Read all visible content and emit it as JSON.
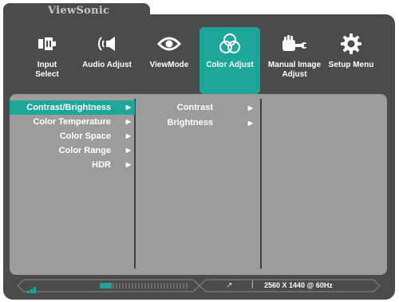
{
  "brand": "ViewSonic",
  "tabs": [
    {
      "label": "Input\nSelect",
      "icon": "input-select-icon"
    },
    {
      "label": "Audio Adjust",
      "icon": "speaker-icon"
    },
    {
      "label": "ViewMode",
      "icon": "eye-icon"
    },
    {
      "label": "Color Adjust",
      "icon": "color-circles-icon",
      "active": true
    },
    {
      "label": "Manual Image\nAdjust",
      "icon": "hand-wrench-icon"
    },
    {
      "label": "Setup Menu",
      "icon": "gear-icon"
    }
  ],
  "menu1": [
    {
      "label": "Contrast/Brightness",
      "selected": true
    },
    {
      "label": "Color Temperature"
    },
    {
      "label": "Color Space"
    },
    {
      "label": "Color Range"
    },
    {
      "label": "HDR"
    }
  ],
  "menu2": [
    {
      "label": "Contrast"
    },
    {
      "label": "Brightness"
    }
  ],
  "arrow": "▶",
  "status": {
    "meter_fill": 0.14,
    "link_icon": "↗",
    "separator": "|",
    "resolution": "2560 X 1440 @ 60Hz"
  },
  "colors": {
    "accent": "#1ea69a",
    "bezel": "#4b4b4b",
    "panel": "#9c9c9c"
  }
}
